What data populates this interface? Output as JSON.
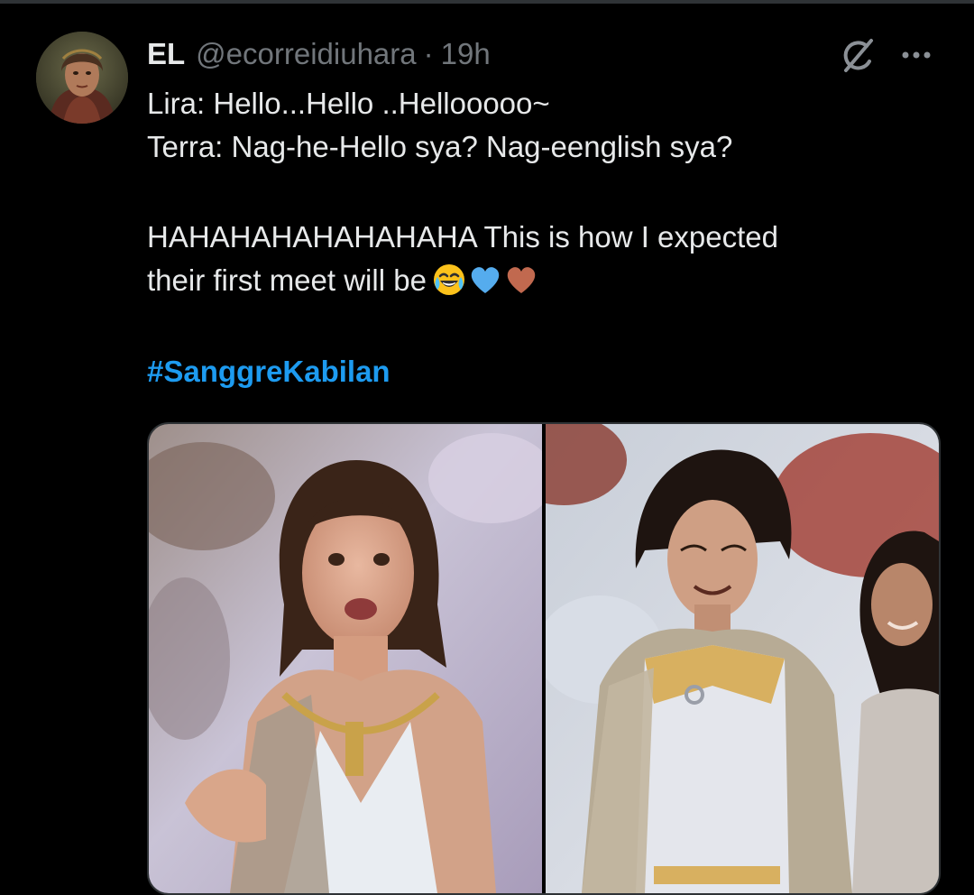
{
  "tweet": {
    "display_name": "EL",
    "handle": "@ecorreidiuhara",
    "separator": "·",
    "time": "19h",
    "lines": [
      "Lira: Hello...Hello ..Hellooooo~",
      "Terra: Nag-he-Hello sya? Nag-eenglish sya?",
      "HAHAHAHAHAHAHAHA This is how I expected",
      "their first meet will be"
    ],
    "emojis": [
      "face-with-tears-of-joy",
      "blue-heart",
      "brown-heart"
    ],
    "hashtag": "#SanggreKabilan"
  },
  "icons": {
    "grok": "grok-icon",
    "more": "more-options-icon"
  },
  "colors": {
    "background": "#000000",
    "text": "#e7e9ea",
    "secondary_text": "#71767b",
    "link": "#1d9bf0",
    "border": "#2f3336"
  }
}
